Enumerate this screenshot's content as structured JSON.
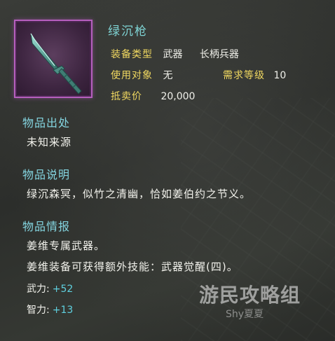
{
  "item": {
    "name": "绿沉枪",
    "equip_type_label": "装备类型",
    "equip_type_value1": "武器",
    "equip_type_value2": "长柄兵器",
    "user_label": "使用对象",
    "user_value": "无",
    "level_label": "需求等级",
    "level_value": "10",
    "price_label": "抵卖价",
    "price_value": "20,000",
    "frame_color": "#b65fbe"
  },
  "origin": {
    "heading": "物品出处",
    "text": "未知来源"
  },
  "description": {
    "heading": "物品说明",
    "text": "绿沉森冥，似竹之清幽，恰如姜伯约之节义。"
  },
  "info": {
    "heading": "物品情报",
    "line1": "姜维专属武器。",
    "line2": "姜维装备可获得额外技能：武器觉醒(四)。"
  },
  "stats": [
    {
      "label": "武力:",
      "value": "+52"
    },
    {
      "label": "智力:",
      "value": "+13"
    }
  ],
  "watermark": {
    "main": "游民攻略组",
    "sub": "Shy夏夏"
  },
  "colors": {
    "label": "#f0d860",
    "heading": "#84d5e0",
    "stat_value": "#5fd0df"
  }
}
